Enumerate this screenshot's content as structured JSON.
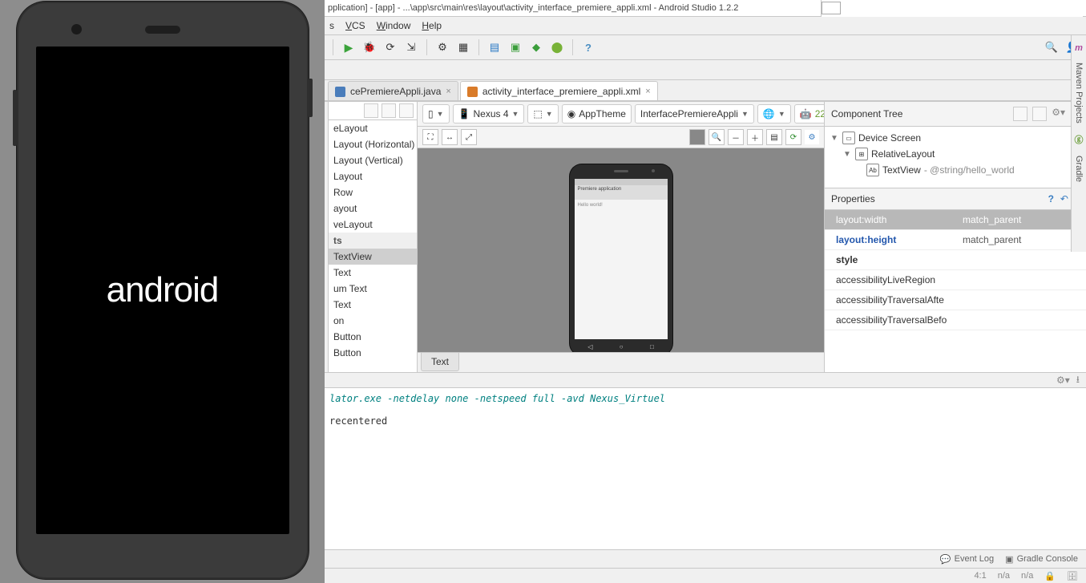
{
  "title_left": "pplication] - [app] - ...\\app\\src\\main\\res\\layout\\activity_interface_premiere_appli.xml - Android Studio 1.2.2",
  "menu": {
    "vcs": "VCS",
    "window": "Window",
    "help": "Help"
  },
  "breadcrumb_tail": "s",
  "tabs": {
    "file1": "cePremiereAppli.java",
    "file2": "activity_interface_premiere_appli.xml"
  },
  "palette": {
    "items": [
      "eLayout",
      "Layout (Horizontal)",
      "Layout (Vertical)",
      "Layout",
      "Row",
      "ayout",
      "veLayout"
    ],
    "group": "ts",
    "widgets": [
      "TextView",
      "Text",
      "um Text",
      "Text",
      "on",
      "Button",
      "Button"
    ]
  },
  "designer_toolbar": {
    "device": "Nexus 4",
    "theme": "AppTheme",
    "activity": "InterfacePremiereAppli",
    "api": "22"
  },
  "preview": {
    "app_title": "Premiere application",
    "body_text": "Hello world!"
  },
  "design_text_tab": "Text",
  "component_tree": {
    "title": "Component Tree",
    "root": "Device Screen",
    "child1": "RelativeLayout",
    "leaf": "TextView",
    "leaf_detail": "@string/hello_world"
  },
  "properties": {
    "title": "Properties",
    "rows": [
      {
        "k": "layout:width",
        "v": "match_parent",
        "header": true
      },
      {
        "k": "layout:height",
        "v": "match_parent",
        "selected": true
      },
      {
        "k": "style",
        "v": ""
      },
      {
        "k": "accessibilityLiveRegion",
        "v": ""
      },
      {
        "k": "accessibilityTraversalAfte",
        "v": ""
      },
      {
        "k": "accessibilityTraversalBefo",
        "v": ""
      }
    ]
  },
  "console": {
    "cmd": "lator.exe -netdelay none -netspeed full -avd Nexus_Virtuel",
    "line2": "recentered"
  },
  "status": {
    "event_log": "Event Log",
    "gradle": "Gradle Console",
    "pos": "4:1",
    "na1": "n/a",
    "na2": "n/a"
  },
  "side": {
    "maven": "Maven Projects",
    "gradle": "Gradle"
  },
  "emulator_text": "android"
}
